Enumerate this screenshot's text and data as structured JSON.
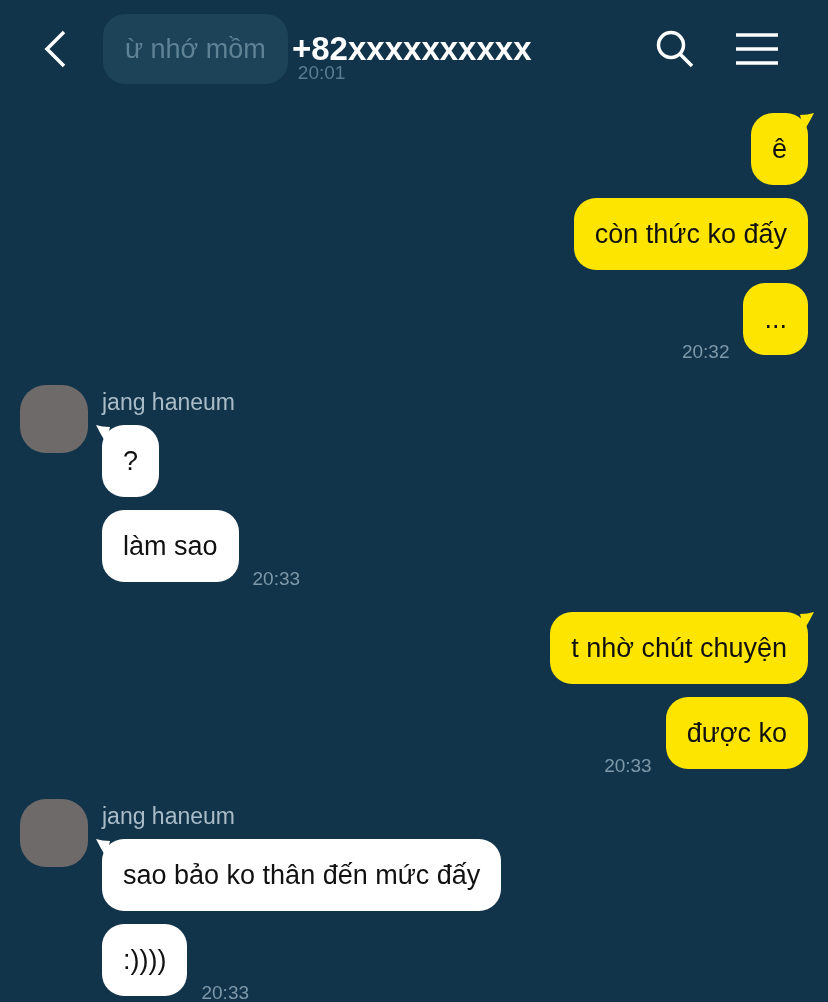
{
  "header": {
    "title": "+82xxxxxxxxxx",
    "faded_message": {
      "text": "ừ nhớ mồm",
      "time": "20:01"
    }
  },
  "groups": [
    {
      "kind": "outgoing",
      "bubbles": [
        "ê",
        "còn thức ko đấy",
        "..."
      ],
      "time": "20:32"
    },
    {
      "kind": "incoming",
      "sender": "jang haneum",
      "bubbles": [
        "?",
        "làm sao"
      ],
      "time": "20:33"
    },
    {
      "kind": "outgoing",
      "bubbles": [
        "t nhờ chút chuyện",
        "được ko"
      ],
      "time": "20:33"
    },
    {
      "kind": "incoming",
      "sender": "jang haneum",
      "bubbles": [
        "sao bảo ko thân đến mức đấy",
        ":))))"
      ],
      "time": "20:33"
    }
  ]
}
